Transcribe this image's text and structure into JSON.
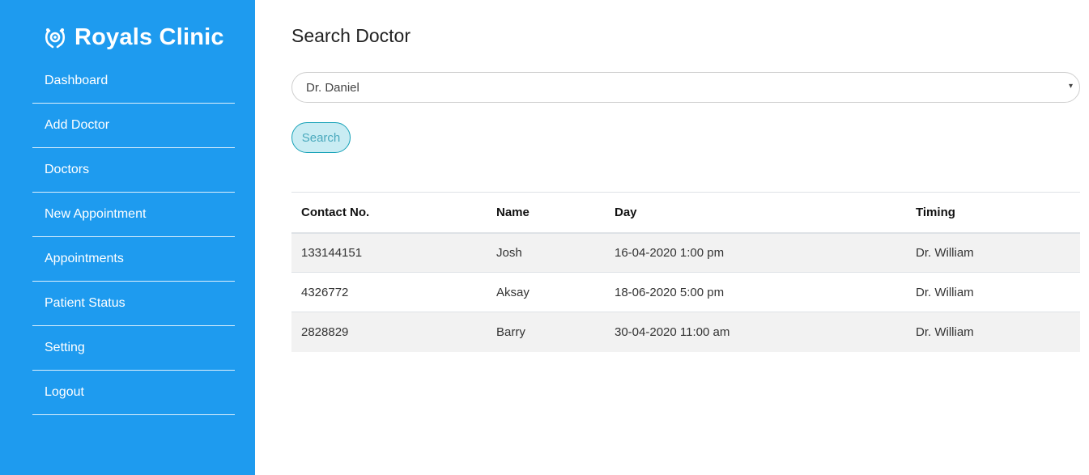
{
  "brand": {
    "name": "Royals Clinic",
    "icon": "stethoscope-logo-icon"
  },
  "sidebar": {
    "items": [
      {
        "label": "Dashboard"
      },
      {
        "label": "Add Doctor"
      },
      {
        "label": "Doctors"
      },
      {
        "label": "New Appointment"
      },
      {
        "label": "Appointments"
      },
      {
        "label": "Patient Status"
      },
      {
        "label": "Setting"
      },
      {
        "label": "Logout"
      }
    ]
  },
  "main": {
    "title": "Search Doctor",
    "doctor_select": {
      "value": "Dr. Daniel",
      "caret": "▾"
    },
    "search_button": "Search",
    "table": {
      "headers": [
        "Contact No.",
        "Name",
        "Day",
        "Timing"
      ],
      "rows": [
        [
          "133144151",
          "Josh",
          "16-04-2020 1:00 pm",
          "Dr. William"
        ],
        [
          "4326772",
          "Aksay",
          "18-06-2020 5:00 pm",
          "Dr. William"
        ],
        [
          "2828829",
          "Barry",
          "30-04-2020 11:00 am",
          "Dr. William"
        ]
      ]
    }
  },
  "colors": {
    "sidebar_bg": "#1e9bef",
    "button_border": "#17a2b8",
    "button_bg": "#c9ecf3",
    "stripe": "#f2f2f2"
  }
}
